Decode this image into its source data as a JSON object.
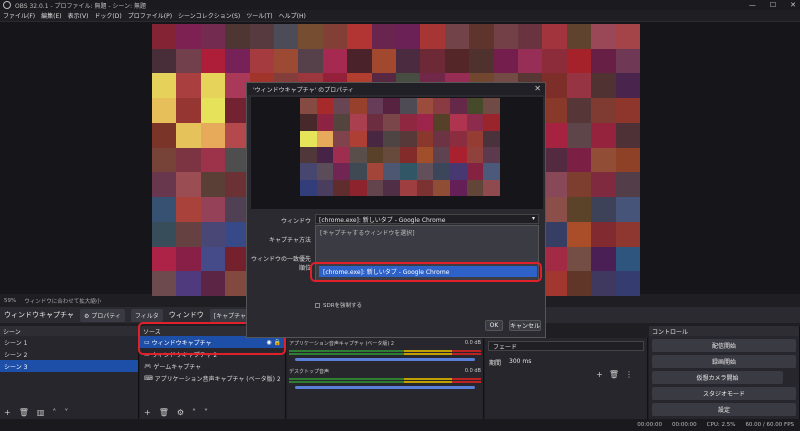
{
  "window": {
    "title": "OBS 32.0.1 - プロファイル: 無題 - シーン: 無題"
  },
  "menu": [
    "ファイル(F)",
    "編集(E)",
    "表示(V)",
    "ドック(D)",
    "プロファイル(P)",
    "シーンコレクション(S)",
    "ツール(T)",
    "ヘルプ(H)"
  ],
  "status_line": {
    "zoom": "59%",
    "hint": "ウィンドウに合わせて拡大縮小"
  },
  "source_toolbar": {
    "source_name": "ウィンドウキャプチャ",
    "properties": "プロパティ",
    "filters": "フィルタ",
    "window_label": "ウィンドウ",
    "window_value": "[キャプチャするウィンドウ]"
  },
  "scenes": {
    "header": "シーン",
    "items": [
      "シーン 1",
      "シーン 2",
      "シーン 3"
    ],
    "selected": 2
  },
  "sources": {
    "header": "ソース",
    "items": [
      "ウィンドウキャプチャ",
      "ウィンドウキャプチャ 2",
      "ゲームキャプチャ",
      "アプリケーション音声キャプチャ (ベータ版) 2"
    ]
  },
  "mixer": {
    "channels": [
      {
        "name": "アプリケーション音声キャプチャ (ベータ版) 2",
        "db": "0.0 dB"
      },
      {
        "name": "デスクトップ音声",
        "db": "0.0 dB"
      }
    ]
  },
  "transition": {
    "type": "フェード",
    "duration_label": "期間",
    "duration": "300 ms"
  },
  "controls": {
    "header": "コントロール",
    "buttons": [
      "配信開始",
      "録画開始",
      "仮想カメラ開始",
      "スタジオモード",
      "設定"
    ]
  },
  "statusbar": {
    "time1": "00:00:00",
    "time2": "00:00:00",
    "cpu": "CPU: 2.5%",
    "fps": "60.00 / 60.00 FPS"
  },
  "dialog": {
    "title": "'ウィンドウキャプチャ' のプロパティ",
    "window_label": "ウィンドウ",
    "window_value": "[chrome.exe]: 新しいタブ - Google Chrome",
    "method_label": "キャプチャ方法",
    "priority_label": "ウィンドウの一致優先順位",
    "dropdown_placeholder": "[キャプチャするウィンドウを選択]",
    "dropdown_selected": "[chrome.exe]: 新しいタブ - Google Chrome",
    "checkbox_label": "SDRを強制する",
    "ok": "OK",
    "cancel": "キャンセル"
  },
  "colors": {
    "accent": "#2f62c9",
    "highlight": "#e0202a"
  }
}
